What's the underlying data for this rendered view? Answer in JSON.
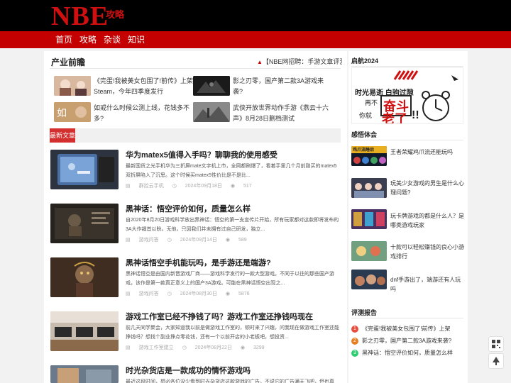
{
  "site": {
    "logo": "NBE",
    "logo_sub": "攻略"
  },
  "nav": [
    "首页",
    "攻略",
    "杂谈",
    "知识"
  ],
  "industry": {
    "title": "产业前瞻",
    "ticker": "【NBE网招聘：手游文章评测写手】",
    "items": [
      {
        "text": "《完蛋!我被美女包围了!前传》上架Steam，今年四季度发行"
      },
      {
        "text": "影之刃零，国产第二款3A游戏来袭?"
      },
      {
        "text": "如戒什么时候公测上线，花钱多不多?"
      },
      {
        "text": "武侠开放世界动作手游《燕云十六声》8月28日删档测试"
      }
    ]
  },
  "latest": {
    "tab": "最新文章",
    "articles": [
      {
        "title": "华为matex5值得入手吗？聊聊我的使用感受",
        "summary": "最新国货之光手机华为三折屏mate文字机上市，全网都刷爆了，看着手里几个月前刚买的matex5双折屏陷入了沉思。这个时候买matex5性价比是不是比...",
        "category": "群控云手机",
        "date": "2024年09月18日",
        "views": "517"
      },
      {
        "title": "黑神话：悟空评价如何，质量怎么样",
        "summary": "自2020年8月20日游戏科学放出黑神话：悟空的第一支宣传片开始，所有玩家都对这款即将发布的3A大作翘首以盼。无他，只因我们并未拥有过自己研发，独立...",
        "category": "游戏问答",
        "date": "2024年09月14日",
        "views": "589"
      },
      {
        "title": "黑神话悟空手机能玩吗，是手游还是端游?",
        "summary": "黑神话悟空是由国内新晋游戏厂商——游戏科学发行的一款大型游戏。不同于以往的那些国产游戏，该作是第一款真正意义上的国产3A游戏。可能在黑神话悟空出现之...",
        "category": "游戏问答",
        "date": "2024年08月30日",
        "views": "5876"
      },
      {
        "title": "游戏工作室已经不挣钱了吗？游戏工作室还挣钱吗现在",
        "summary": "前几天同学聚会，大家知道我以前是做游戏工作室的，顿时来了兴趣，问我现在做游戏工作室还能挣钱吗？想找个副业挣点零花钱，还有一个以前开店的小老板吧，想投资...",
        "category": "游戏工作室建立",
        "date": "2024年08月22日",
        "views": "3299"
      },
      {
        "title": "时光杂货店是一款成功的情怀游戏吗",
        "summary": "最近这段时间，想必各位没少看到时光杂货店这款游戏的广告。不说它的广告满天飞吧，但也真心...",
        "category": "",
        "date": "",
        "views": ""
      }
    ]
  },
  "sidebar": {
    "qihang_title": "启航2024",
    "banner": {
      "line1": "时光易逝 白驹过隙",
      "line2": "再不",
      "line3": "奋斗",
      "line4": "你就",
      "line5": "老了",
      "line6": "!!"
    },
    "feel_title": "感悟体会",
    "feel_items": [
      {
        "thumb": "鸡爪流睡后",
        "text": "王者荣耀鸡爪流还能玩吗"
      },
      {
        "thumb": "",
        "text": "玩美少女游戏的男生是什么心理问题?"
      },
      {
        "thumb": "",
        "text": "玩卡牌游戏的都是什么人？是哪类游戏玩家"
      },
      {
        "thumb": "",
        "text": "十款可以轻松赚钱的良心小游戏排行"
      },
      {
        "thumb": "",
        "text": "dnf手游出了，端游还有人玩吗"
      }
    ],
    "review_title": "评测报告",
    "review_items": [
      {
        "num": "1",
        "text": "《完蛋!我被美女包围了!前传》上架"
      },
      {
        "num": "2",
        "text": "影之刃零，国产第二款3A游戏来袭?"
      },
      {
        "num": "3",
        "text": "黑神话：悟空评价如何，质量怎么样"
      }
    ]
  },
  "colors": {
    "brand": "#c40000",
    "accent": "#d32f2f",
    "rank1": "#e74c3c",
    "rank2": "#e67e22",
    "rank3": "#2ecc71"
  },
  "icons": {
    "ticker_dot": "▲",
    "views": "👁",
    "category": "📄",
    "date": "🕒",
    "qr": "qr-code-icon",
    "top": "▲"
  }
}
